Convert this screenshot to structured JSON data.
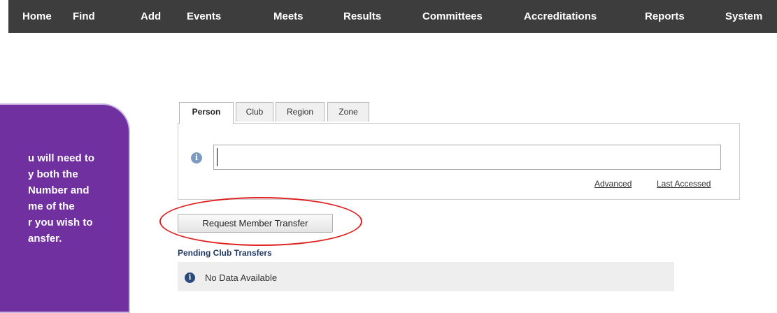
{
  "nav": {
    "items": [
      "Home",
      "Find",
      "Add",
      "Events",
      "Meets",
      "Results",
      "Committees",
      "Accreditations",
      "Reports",
      "System"
    ]
  },
  "callout": {
    "lines": [
      "u will need to",
      "y both the",
      " Number and",
      "me of the",
      "r you wish to",
      "ansfer."
    ]
  },
  "search": {
    "tabs": [
      "Person",
      "Club",
      "Region",
      "Zone"
    ],
    "active_tab": "Person",
    "input_value": "",
    "advanced_label": "Advanced",
    "last_accessed_label": "Last Accessed"
  },
  "transfer": {
    "button_label": "Request Member Transfer"
  },
  "pending": {
    "title": "Pending Club Transfers",
    "empty_text": "No Data Available"
  },
  "colors": {
    "navbar": "#3d3d3d",
    "callout": "#7030a0",
    "highlight_ring": "#e02020",
    "section_title": "#1f3864"
  }
}
